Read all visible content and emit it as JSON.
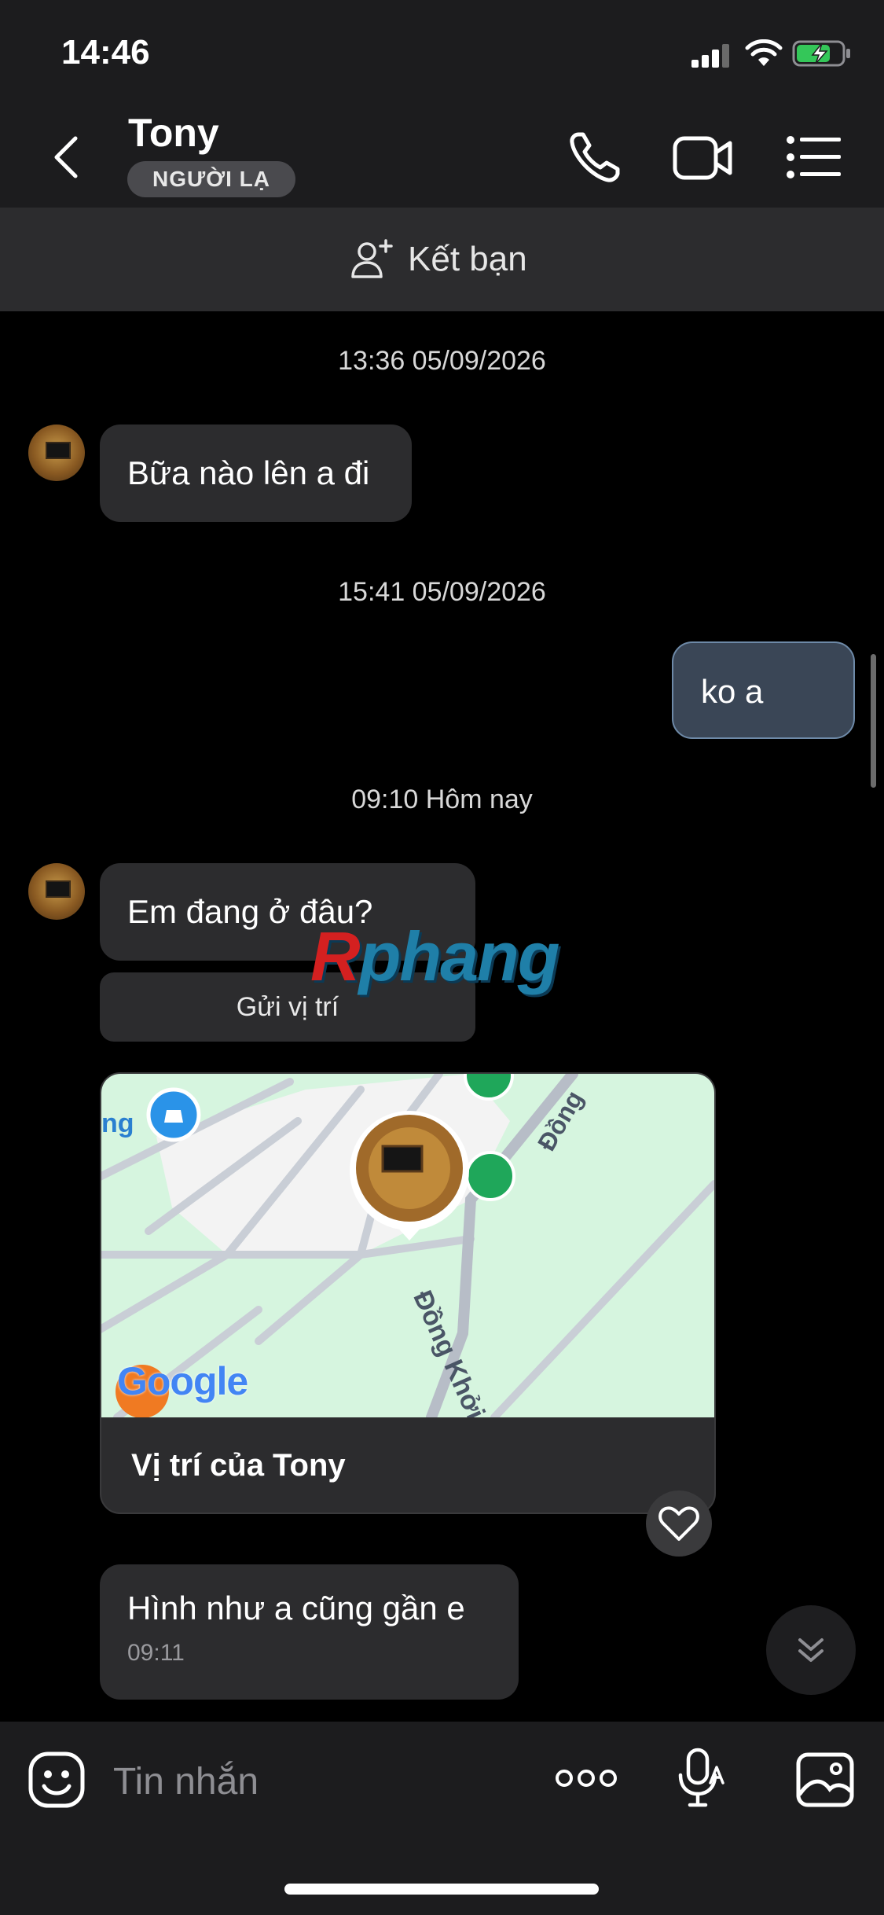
{
  "status_bar": {
    "time": "14:46"
  },
  "header": {
    "name": "Tony",
    "badge": "NGƯỜI LẠ"
  },
  "add_friend": {
    "label": "Kết bạn"
  },
  "messages": [
    {
      "timestamp": "13:36 05/09/2026",
      "text": "Bữa nào lên a đi"
    },
    {
      "timestamp": "15:41 05/09/2026",
      "text": "ko a"
    },
    {
      "timestamp": "09:10 Hôm nay",
      "text": "Em đang ở đâu?"
    }
  ],
  "send_location": {
    "label": "Gửi vị trí"
  },
  "map_card": {
    "title": "Vị trí của Tony",
    "street_1": "Đồng Khởi",
    "street_2": "Đồng",
    "place_fragment": "ng",
    "map_brand": "Google"
  },
  "last_message": {
    "text": "Hình như a cũng gần e",
    "time": "09:11"
  },
  "composer": {
    "placeholder": "Tin nhắn"
  },
  "watermark": {
    "prefix": "R",
    "rest": "phang"
  }
}
